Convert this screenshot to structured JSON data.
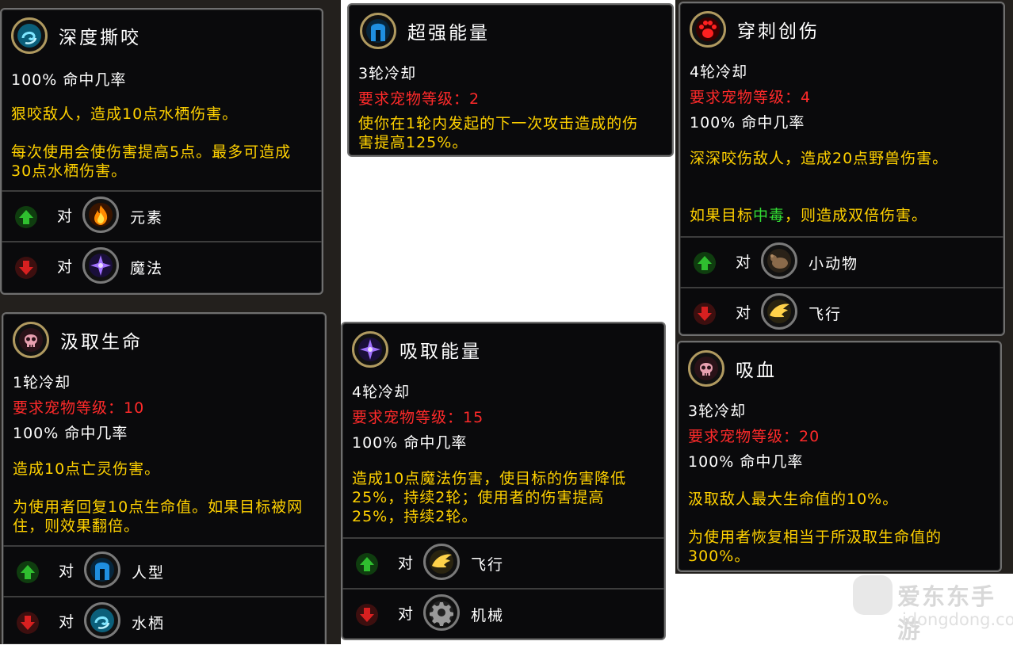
{
  "cards": [
    {
      "title": "深度撕咬",
      "icon": "water-swirl-icon",
      "lines": [
        {
          "text": "100% 命中几率",
          "color": "white"
        }
      ],
      "paragraphs": [
        "狠咬敌人，造成10点水栖伤害。",
        "每次使用会使伤害提高5点。最多可造成30点水栖伤害。"
      ],
      "strong_label": "对",
      "strong_against": "元素",
      "strong_icon": "fire-icon",
      "weak_label": "对",
      "weak_against": "魔法",
      "weak_icon": "arcane-star-icon"
    },
    {
      "title": "超强能量",
      "icon": "helmet-icon",
      "lines": [
        {
          "text": "3轮冷却",
          "color": "white"
        },
        {
          "text": "要求宠物等级：2",
          "color": "red"
        }
      ],
      "paragraphs": [
        "使你在1轮内发起的下一次攻击造成的伤害提高125%。"
      ]
    },
    {
      "title": "穿刺创伤",
      "icon": "paw-icon",
      "lines": [
        {
          "text": "4轮冷却",
          "color": "white"
        },
        {
          "text": "要求宠物等级：4",
          "color": "red"
        },
        {
          "text": "100% 命中几率",
          "color": "white"
        }
      ],
      "paragraphs": [
        "深深咬伤敌人，造成20点野兽伤害。"
      ],
      "poison_pre": "如果目标",
      "poison_word": "中毒",
      "poison_post": "，则造成双倍伤害。",
      "strong_label": "对",
      "strong_against": "小动物",
      "strong_icon": "critter-icon",
      "weak_label": "对",
      "weak_against": "飞行",
      "weak_icon": "wing-icon"
    },
    {
      "title": "汲取生命",
      "icon": "skull-icon",
      "lines": [
        {
          "text": "1轮冷却",
          "color": "white"
        },
        {
          "text": "要求宠物等级：10",
          "color": "red"
        },
        {
          "text": "100% 命中几率",
          "color": "white"
        }
      ],
      "paragraphs": [
        "造成10点亡灵伤害。",
        "为使用者回复10点生命值。如果目标被网住，则效果翻倍。"
      ],
      "strong_label": "对",
      "strong_against": "人型",
      "strong_icon": "helmet-icon",
      "weak_label": "对",
      "weak_against": "水栖",
      "weak_icon": "water-swirl-icon"
    },
    {
      "title": "吸取能量",
      "icon": "arcane-star-icon",
      "lines": [
        {
          "text": "4轮冷却",
          "color": "white"
        },
        {
          "text": "要求宠物等级：15",
          "color": "red"
        },
        {
          "text": "100% 命中几率",
          "color": "white"
        }
      ],
      "paragraphs": [
        "造成10点魔法伤害，使目标的伤害降低25%，持续2轮；使用者的伤害提高25%，持续2轮。"
      ],
      "strong_label": "对",
      "strong_against": "飞行",
      "strong_icon": "wing-icon",
      "weak_label": "对",
      "weak_against": "机械",
      "weak_icon": "gear-icon"
    },
    {
      "title": "吸血",
      "icon": "skull-icon",
      "lines": [
        {
          "text": "3轮冷却",
          "color": "white"
        },
        {
          "text": "要求宠物等级：20",
          "color": "red"
        },
        {
          "text": "100% 命中几率",
          "color": "white"
        }
      ],
      "paragraphs": [
        "汲取敌人最大生命值的10%。",
        "为使用者恢复相当于所汲取生命值的300%。"
      ]
    }
  ],
  "watermark": {
    "title": "爱东东手游",
    "url": "idongdong.com"
  },
  "colors": {
    "title": "#ffffff",
    "body": "#ffd100",
    "requirement": "#ff2a2a",
    "poison": "#33dd33",
    "strong_arrow": "#1f9a1f",
    "weak_arrow": "#b01818"
  }
}
